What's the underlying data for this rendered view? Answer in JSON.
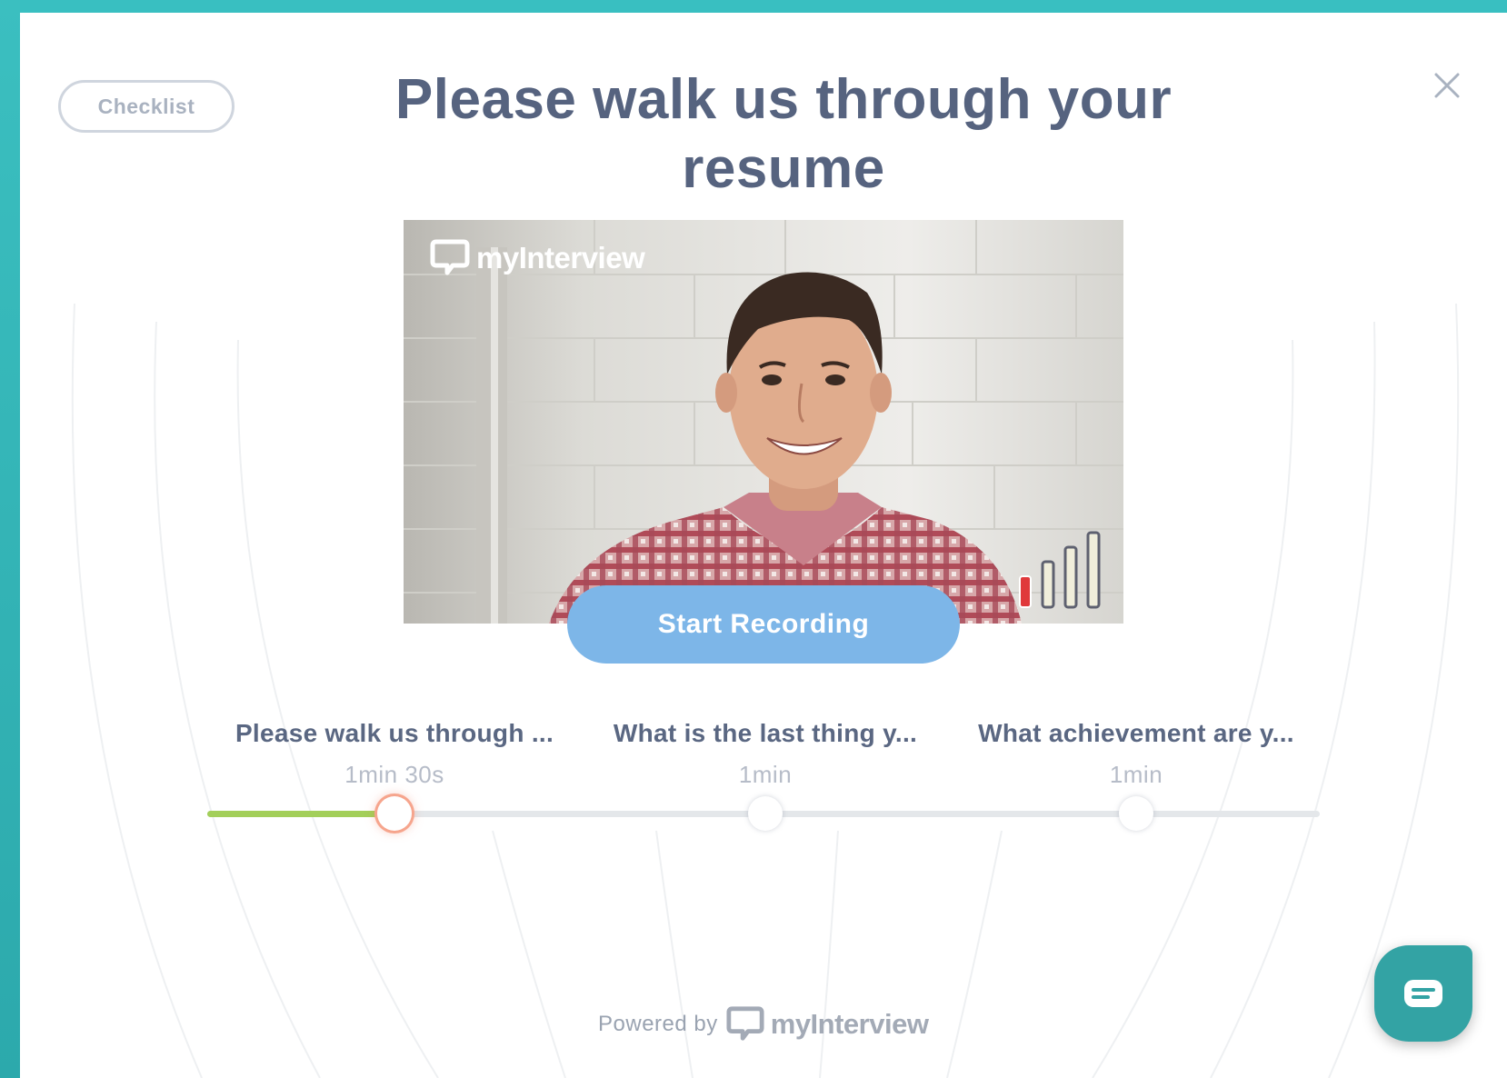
{
  "header": {
    "checklist_label": "Checklist",
    "title_line1": "Please walk us through your",
    "title_line2": "resume"
  },
  "video": {
    "brand": "myInterview",
    "mic_level_bars_active": 1,
    "mic_level_bars_total": 4
  },
  "record_button_label": "Start Recording",
  "questions": [
    {
      "label": "Please walk us through ...",
      "duration": "1min 30s",
      "active": true
    },
    {
      "label": "What is the last thing y...",
      "duration": "1min",
      "active": false
    },
    {
      "label": "What achievement are y...",
      "duration": "1min",
      "active": false
    }
  ],
  "progress_fraction": 0.17,
  "footer": {
    "powered_by": "Powered by",
    "brand": "myInterview"
  },
  "colors": {
    "frame": "#2fb8b9",
    "title": "#56637f",
    "record_button": "#7db6e8",
    "progress": "#a3cf5a",
    "active_step": "#f6a58d",
    "chat_button": "#33a3a4",
    "mic_active": "#e0393b"
  },
  "icons": {
    "close": "close-icon",
    "chat": "chat-icon",
    "logo": "speech-bubble-logo-icon",
    "mic": "signal-bars-icon"
  }
}
